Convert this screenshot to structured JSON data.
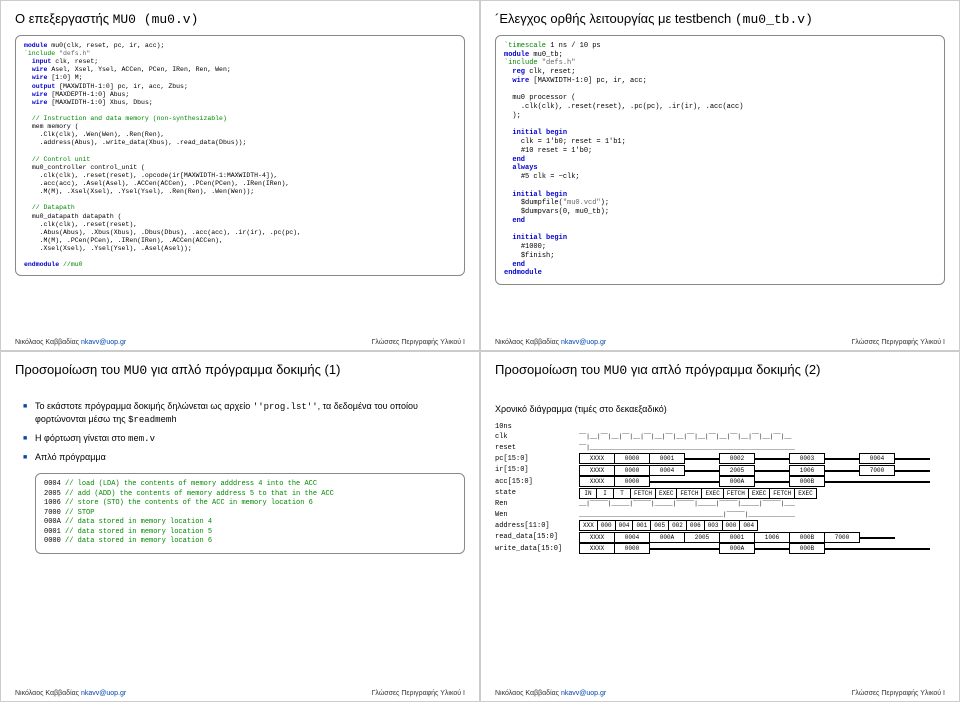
{
  "slide1": {
    "title_pre": "Ο επεξεργαστής ",
    "title_mono": "MU0 (mu0.v)",
    "code": "module mu0(clk, reset, pc, ir, acc);\n`include \"defs.h\"\n  input clk, reset;\n  wire Asel, Xsel, Ysel, ACCen, PCen, IRen, Ren, Wen;\n  wire [1:0] M;\n  output [MAXWIDTH-1:0] pc, ir, acc, Zbus;\n  wire [MAXDEPTH-1:0] Abus;\n  wire [MAXWIDTH-1:0] Xbus, Dbus;\n\n  // Instruction and data memory (non-synthesizable)\n  mem memory (\n    .Clk(clk), .Wen(Wen), .Ren(Ren),\n    .address(Abus), .write_data(Xbus), .read_data(Dbus));\n\n  // Control unit\n  mu0_controller control_unit (\n    .clk(clk), .reset(reset), .opcode(ir[MAXWIDTH-1:MAXWIDTH-4]),\n    .acc(acc), .Asel(Asel), .ACCen(ACCen), .PCen(PCen), .IRen(IRen),\n    .M(M), .Xsel(Xsel), .Ysel(Ysel), .Ren(Ren), .Wen(Wen));\n\n  // Datapath\n  mu0_datapath datapath (\n    .clk(clk), .reset(reset),\n    .Abus(Abus), .Xbus(Xbus), .Dbus(Dbus), .acc(acc), .ir(ir), .pc(pc),\n    .M(M), .PCen(PCen), .IRen(IRen), .ACCen(ACCen),\n    .Xsel(Xsel), .Ysel(Ysel), .Asel(Asel));\n\nendmodule //mu0"
  },
  "slide2": {
    "title_pre": "´Ελεγχος ορθής λειτουργίας με testbench ",
    "title_mono": "(mu0_tb.v)",
    "code": "`timescale 1 ns / 10 ps\nmodule mu0_tb;\n`include \"defs.h\"\n  reg clk, reset;\n  wire [MAXWIDTH-1:0] pc, ir, acc;\n\n  mu0 processor (\n    .clk(clk), .reset(reset), .pc(pc), .ir(ir), .acc(acc)\n  );\n\n  initial begin\n    clk = 1'b0; reset = 1'b1;\n    #10 reset = 1'b0;\n  end\n  always\n    #5 clk = ~clk;\n\n  initial begin\n    $dumpfile(\"mu0.vcd\");\n    $dumpvars(0, mu0_tb);\n  end\n\n  initial begin\n    #1000;\n    $finish;\n  end\nendmodule"
  },
  "slide3": {
    "title_pre": "Προσομοίωση του ",
    "title_mono": "MU0",
    "title_post": " για απλό πρόγραμμα δοκιμής (1)",
    "b1_a": "Το εκάστοτε πρόγραμμα δοκιμής δηλώνεται ως αρχείο ",
    "b1_b": "''prog.lst''",
    "b1_c": ", τα δεδομένα του οποίου φορτώνονται μέσω της ",
    "b1_d": "$readmemh",
    "b2_a": "Η φόρτωση γίνεται στο ",
    "b2_b": "mem.v",
    "b3": "Απλό πρόγραμμα",
    "prog": "0004 // load (LDA) the contents of memory adddress 4 into the ACC\n2005 // add (ADD) the contents of memory address 5 to that in the ACC\n1006 // store (STO) the contents of the ACC in memory location 6\n7000 // STOP\n000A // data stored in memory location 4\n0001 // data stored in memory location 5\n0000 // data stored in memory location 6"
  },
  "slide4": {
    "title_pre": "Προσομοίωση του ",
    "title_mono": "MU0",
    "title_post": " για απλό πρόγραμμα δοκιμής (2)",
    "caption": "Χρονικό διάγραμμα (τιμές στο δεκαεξαδικό)",
    "rows": {
      "time": "10ns",
      "clk": "clk",
      "reset": "reset",
      "pc": "pc[15:0]",
      "pc_vals": [
        "XXXX",
        "0000",
        "0001",
        "",
        "0002",
        "",
        "0003",
        "",
        "0004",
        ""
      ],
      "ir": "ir[15:0]",
      "ir_vals": [
        "XXXX",
        "0000",
        "0004",
        "",
        "2005",
        "",
        "1006",
        "",
        "7000",
        ""
      ],
      "acc": "acc[15:0]",
      "acc_vals": [
        "XXXX",
        "0000",
        "",
        "",
        "000A",
        "",
        "000B",
        "",
        "",
        ""
      ],
      "state": "state",
      "state_vals": [
        "IN",
        "I",
        "T",
        "FETCH",
        "EXEC",
        "FETCH",
        "EXEC",
        "FETCH",
        "EXEC",
        "FETCH",
        "EXEC"
      ],
      "ren": "Ren",
      "wen": "Wen",
      "addr": "address[11:0]",
      "addr_vals": [
        "XXX",
        "000",
        "004",
        "001",
        "005",
        "002",
        "006",
        "003",
        "000",
        "004"
      ],
      "rdata": "read_data[15:0]",
      "rdata_vals": [
        "XXXX",
        "0004",
        "000A",
        "2005",
        "0001",
        "1006",
        "000B",
        "7000",
        ""
      ],
      "wdata": "write_data[15:0]",
      "wdata_vals": [
        "XXXX",
        "0000",
        "",
        "",
        "000A",
        "",
        "000B",
        "",
        "",
        ""
      ]
    }
  },
  "footer": {
    "left_name": "Νικόλαος Καββαδίας ",
    "left_email": "nkavv@uop.gr",
    "right": "Γλώσσες Περιγραφής Υλικού Ι"
  }
}
